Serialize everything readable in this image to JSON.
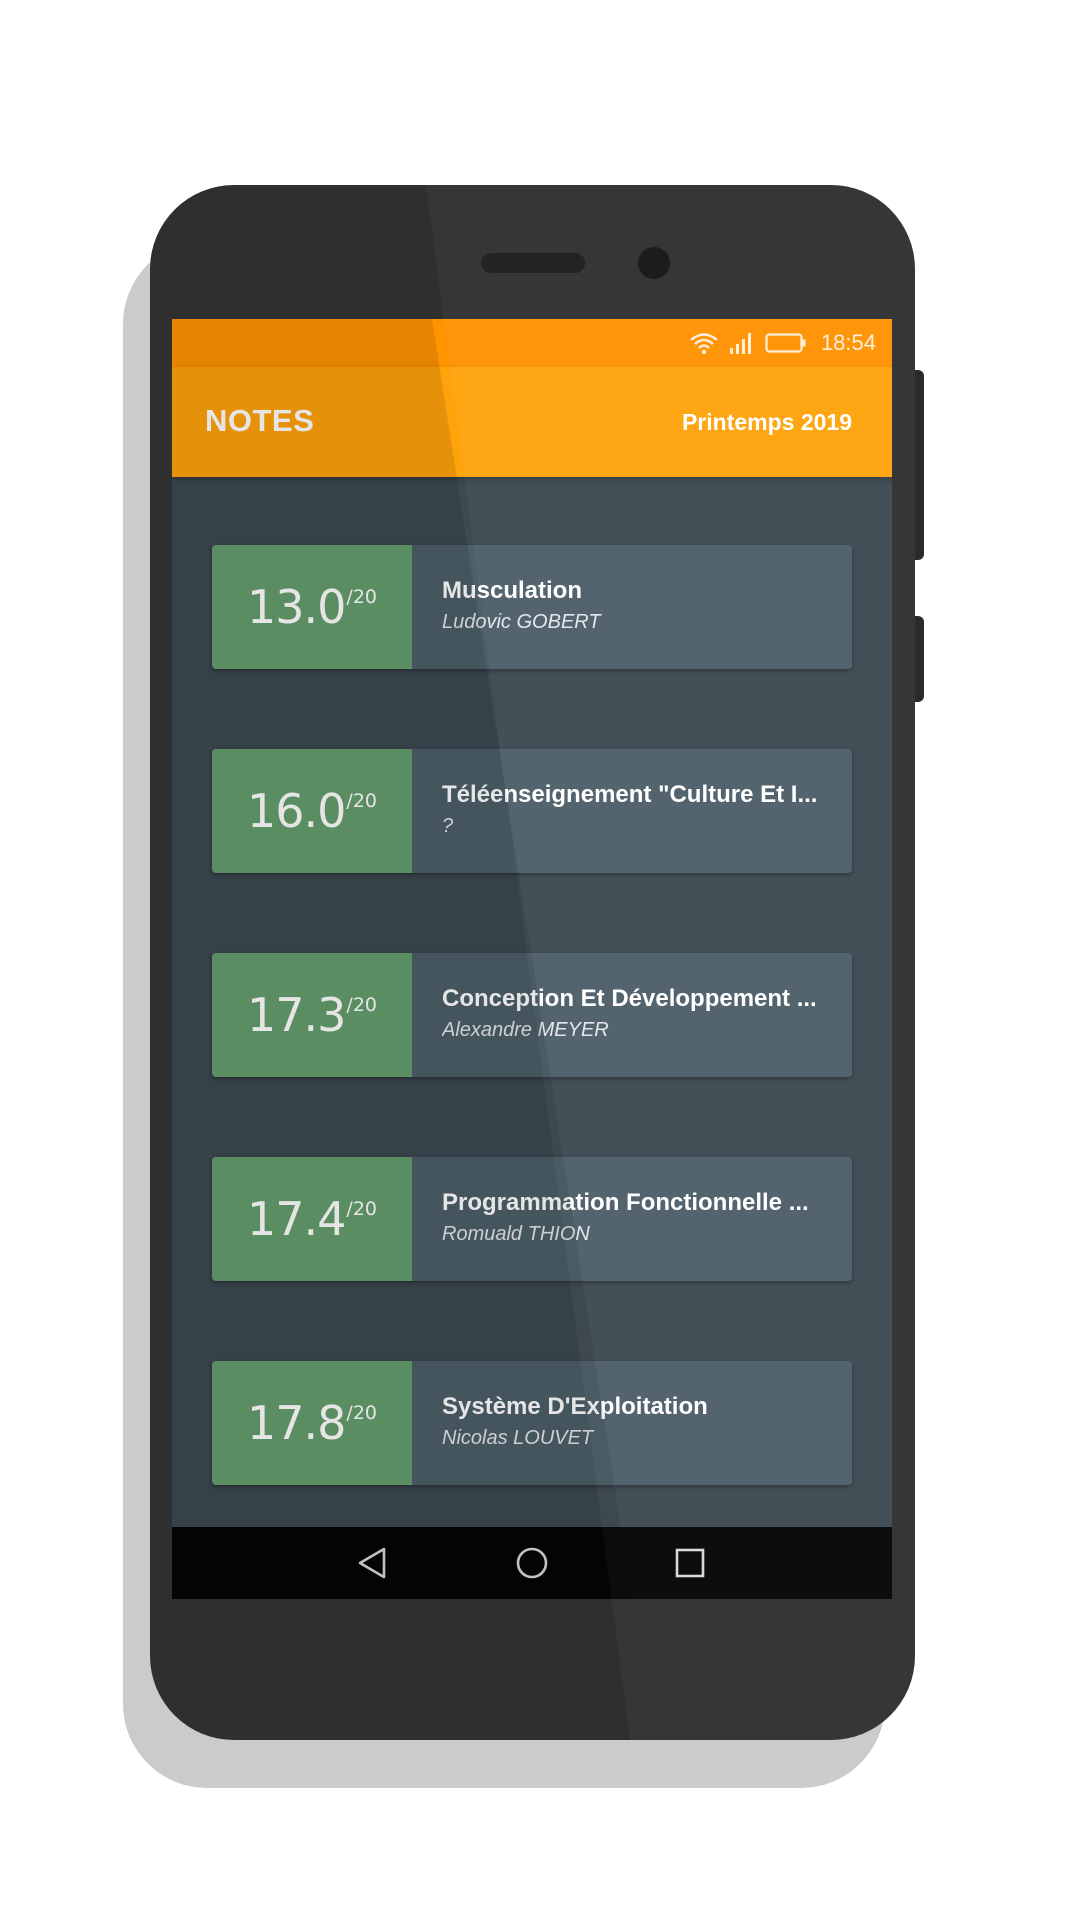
{
  "status_bar": {
    "time": "18:54",
    "icons": [
      "wifi-icon",
      "signal-icon",
      "battery-icon"
    ]
  },
  "app_bar": {
    "title": "NOTES",
    "semester": "Printemps 2019"
  },
  "grades": [
    {
      "grade": "13.0",
      "max": "/20",
      "course": "Musculation",
      "teacher": "Ludovic GOBERT"
    },
    {
      "grade": "16.0",
      "max": "/20",
      "course": "Téléenseignement \"Culture Et I...",
      "teacher": "?"
    },
    {
      "grade": "17.3",
      "max": "/20",
      "course": "Conception Et Développement ...",
      "teacher": "Alexandre MEYER"
    },
    {
      "grade": "17.4",
      "max": "/20",
      "course": "Programmation Fonctionnelle ...",
      "teacher": "Romuald THION"
    },
    {
      "grade": "17.8",
      "max": "/20",
      "course": "Système D'Exploitation",
      "teacher": "Nicolas LOUVET"
    }
  ],
  "nav_bar": {
    "icons": [
      "back-icon",
      "home-icon",
      "recents-icon"
    ]
  },
  "colors": {
    "status_bar": "#ff9300",
    "app_bar": "#ffa30c",
    "screen_background": "#3d4a52",
    "card_background": "#4d5f69",
    "grade_box": "#659d6c",
    "device_body": "#2f2f2f"
  }
}
